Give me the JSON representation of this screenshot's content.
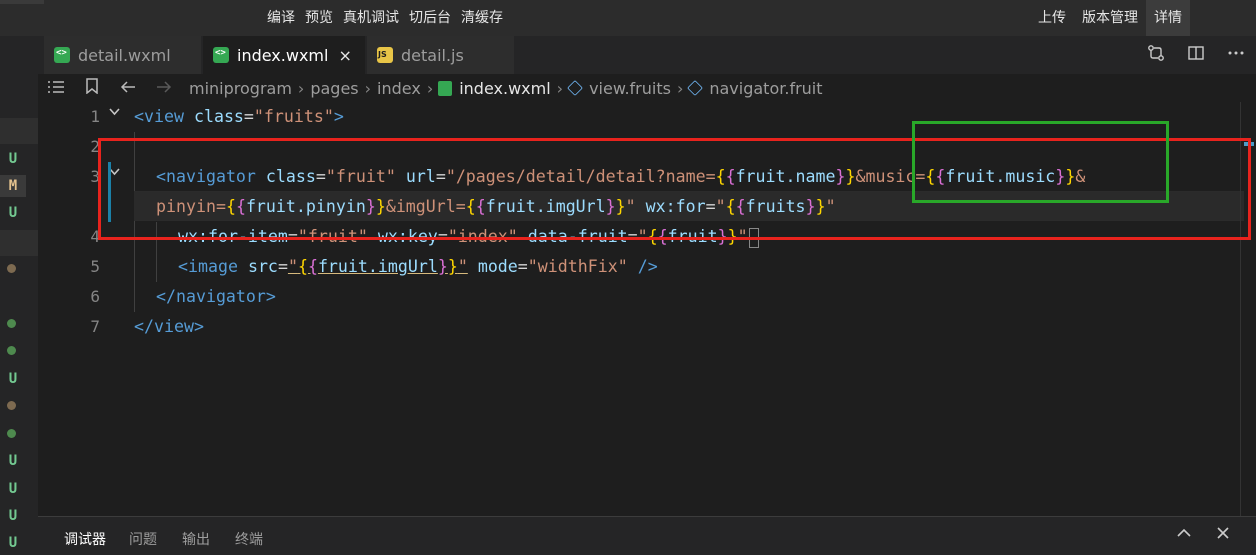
{
  "toolbar": {
    "left_items": [
      {
        "id": "compile",
        "label": "编译"
      },
      {
        "id": "preview",
        "label": "预览"
      },
      {
        "id": "remote-debug",
        "label": "真机调试"
      },
      {
        "id": "background",
        "label": "切后台"
      },
      {
        "id": "clear-cache",
        "label": "清缓存"
      }
    ],
    "right_items": [
      {
        "id": "upload",
        "label": "上传"
      },
      {
        "id": "version",
        "label": "版本管理"
      },
      {
        "id": "details",
        "label": "详情"
      }
    ]
  },
  "git_status": {
    "marks": [
      "U",
      "M",
      "U",
      "U",
      "U",
      "U",
      "U",
      "U"
    ],
    "colors": {
      "untracked": "#73c991",
      "modified": "#e2c08d",
      "dot_green": "#4e8a4e",
      "dot_brown": "#7d6a50"
    }
  },
  "tabs": [
    {
      "label": "detail.wxml",
      "icon": "wxml-file-icon",
      "active": false
    },
    {
      "label": "index.wxml",
      "icon": "wxml-file-icon",
      "active": true,
      "close": "×"
    },
    {
      "label": "detail.js",
      "icon": "js-file-icon",
      "active": false
    }
  ],
  "breadcrumb": [
    "miniprogram",
    "pages",
    "index",
    "index.wxml",
    "view.fruits",
    "navigator.fruit"
  ],
  "editor": {
    "line_numbers": [
      "1",
      "2",
      "3",
      "",
      "4",
      "5",
      "6",
      "7"
    ],
    "lines": {
      "l1": {
        "tag": "view",
        "attr": "class",
        "val": "fruits"
      },
      "l3": {
        "tag": "navigator",
        "class_attr": "class",
        "class_val": "fruit",
        "url_attr": "url",
        "url_1": "/pages/detail/detail?name=",
        "expr_name": "fruit.name",
        "url_2": "&music=",
        "expr_music": "fruit.music",
        "url_3": "&",
        "url_4": "pinyin=",
        "expr_pinyin": "fruit.pinyin",
        "url_5": "&imgUrl=",
        "expr_img": "fruit.imgUrl",
        "for_attr": "wx:for",
        "expr_fruits": "fruits"
      },
      "l4": {
        "item_attr": "wx:for-item",
        "item_val": "fruit",
        "key_attr": "wx:key",
        "key_val": "index",
        "data_attr": "data-fruit",
        "expr_fruit": "fruit"
      },
      "l5": {
        "tag": "image",
        "src_attr": "src",
        "expr_img": "fruit.imgUrl",
        "mode_attr": "mode",
        "mode_val": "widthFix"
      },
      "l6": {
        "tag": "navigator"
      },
      "l7": {
        "tag": "view"
      }
    }
  },
  "annotations": {
    "red": "#e8231d",
    "green": "#29a829"
  },
  "panel": {
    "tabs": [
      {
        "label": "调试器",
        "active": true
      },
      {
        "label": "问题",
        "active": false
      },
      {
        "label": "输出",
        "active": false
      },
      {
        "label": "终端",
        "active": false
      }
    ]
  }
}
